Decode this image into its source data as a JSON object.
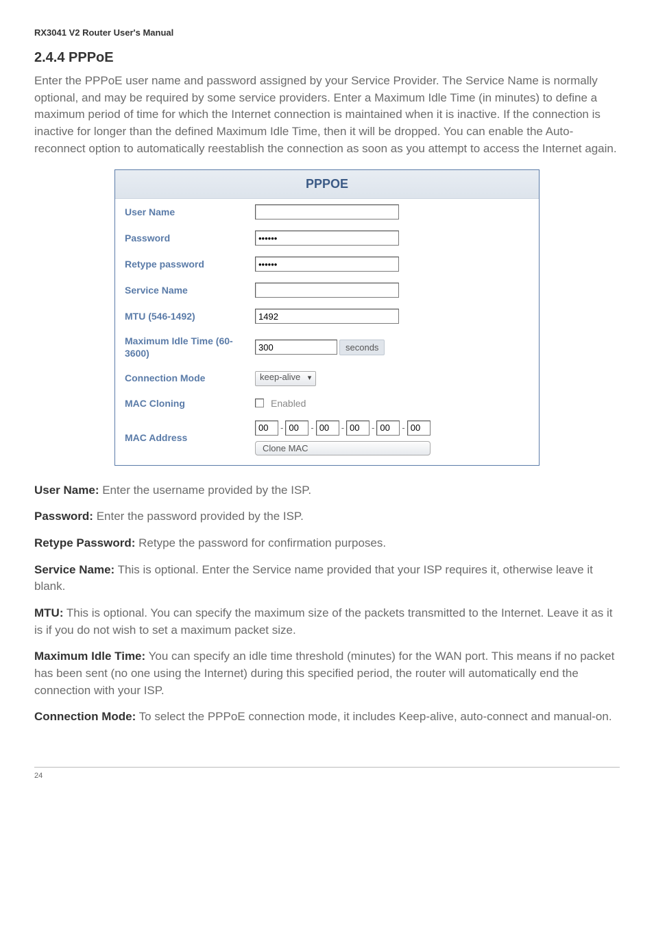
{
  "doc_header": "RX3041 V2 Router User's Manual",
  "section_title": "2.4.4 PPPoE",
  "intro": "Enter the PPPoE user name and password assigned by your Service Provider. The Service Name is normally optional, and may be required by some service providers. Enter a Maximum Idle Time (in minutes) to define a maximum period of time for which the Internet connection is maintained when it is inactive. If the connection is inactive for longer than the defined Maximum Idle Time, then it will be dropped. You can enable the Auto-reconnect option to automatically reestablish the connection as soon as you attempt to access the Internet again.",
  "form": {
    "title": "PPPOE",
    "labels": {
      "user_name": "User Name",
      "password": "Password",
      "retype_password": "Retype password",
      "service_name": "Service Name",
      "mtu": "MTU (546-1492)",
      "max_idle": "Maximum Idle Time (60-3600)",
      "connection_mode": "Connection Mode",
      "mac_cloning": "MAC Cloning",
      "mac_address": "MAC Address"
    },
    "values": {
      "user_name": "",
      "password": "••••••",
      "retype_password": "••••••",
      "service_name": "",
      "mtu": "1492",
      "idle_time": "300",
      "seconds_label": "seconds",
      "connection_mode": "keep-alive",
      "enabled_label": "Enabled",
      "mac": [
        "00",
        "00",
        "00",
        "00",
        "00",
        "00"
      ],
      "clone_btn": "Clone MAC"
    }
  },
  "defs": {
    "user_name_term": "User Name:",
    "user_name_text": " Enter the username provided by the ISP.",
    "password_term": "Password:",
    "password_text": " Enter the password provided by the ISP.",
    "retype_term": "Retype Password:",
    "retype_text": " Retype the password for confirmation purposes.",
    "service_term": "Service Name:",
    "service_text": " This is optional. Enter the Service name provided that your ISP requires it, otherwise leave it blank.",
    "mtu_term": "MTU:",
    "mtu_text": " This is optional. You can specify the maximum size of the packets transmitted to the Internet. Leave it as it is if you do not wish to set a maximum packet size.",
    "idle_term": "Maximum Idle Time:",
    "idle_text": " You can specify an idle time threshold (minutes) for the WAN port. This means if no packet has been sent (no one using the Internet) during this specified period, the router will automatically end the connection with your ISP.",
    "conn_term": "Connection Mode:",
    "conn_text": " To select the PPPoE connection mode, it includes Keep-alive, auto-connect and manual-on."
  },
  "page_number": "24"
}
